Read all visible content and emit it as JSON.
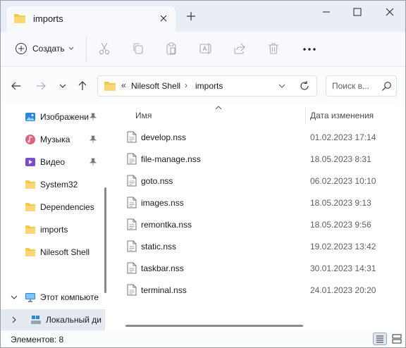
{
  "window": {
    "tab_title": "imports",
    "colors": {
      "folder": "#f2c94c",
      "accent": "#0067c0"
    }
  },
  "commandbar": {
    "create_label": "Создать",
    "icons": [
      "cut-icon",
      "copy-icon",
      "paste-icon",
      "rename-icon",
      "share-icon",
      "delete-icon",
      "more-icon"
    ]
  },
  "address": {
    "overflow_glyph": "«",
    "segments": [
      "Nilesoft Shell",
      "imports"
    ],
    "separator": "›"
  },
  "search": {
    "placeholder": "Поиск в..."
  },
  "sidebar": {
    "items": [
      {
        "label": "Изображени",
        "icon": "pictures-icon",
        "pinned": true
      },
      {
        "label": "Музыка",
        "icon": "music-icon",
        "pinned": true
      },
      {
        "label": "Видео",
        "icon": "video-icon",
        "pinned": true
      },
      {
        "label": "System32",
        "icon": "folder-icon",
        "pinned": false
      },
      {
        "label": "Dependencies",
        "icon": "folder-icon",
        "pinned": false
      },
      {
        "label": "imports",
        "icon": "folder-icon",
        "pinned": false
      },
      {
        "label": "Nilesoft Shell",
        "icon": "folder-icon",
        "pinned": false
      },
      {
        "label": "Этот компьюте",
        "icon": "pc-icon",
        "expanded": true
      },
      {
        "label": "Локальный ди",
        "icon": "disk-icon",
        "selected": true
      }
    ]
  },
  "filelist": {
    "columns": {
      "name": "Имя",
      "date": "Дата изменения"
    },
    "files": [
      {
        "name": "develop.nss",
        "date": "01.02.2023 17:14"
      },
      {
        "name": "file-manage.nss",
        "date": "18.05.2023 8:31"
      },
      {
        "name": "goto.nss",
        "date": "06.02.2023 10:10"
      },
      {
        "name": "images.nss",
        "date": "18.05.2023 9:13"
      },
      {
        "name": "remontka.nss",
        "date": "18.05.2023 9:56"
      },
      {
        "name": "static.nss",
        "date": "19.02.2023 13:42"
      },
      {
        "name": "taskbar.nss",
        "date": "30.01.2023 14:31"
      },
      {
        "name": "terminal.nss",
        "date": "24.01.2023 20:20"
      }
    ]
  },
  "status": {
    "items_text": "Элементов: 8"
  }
}
